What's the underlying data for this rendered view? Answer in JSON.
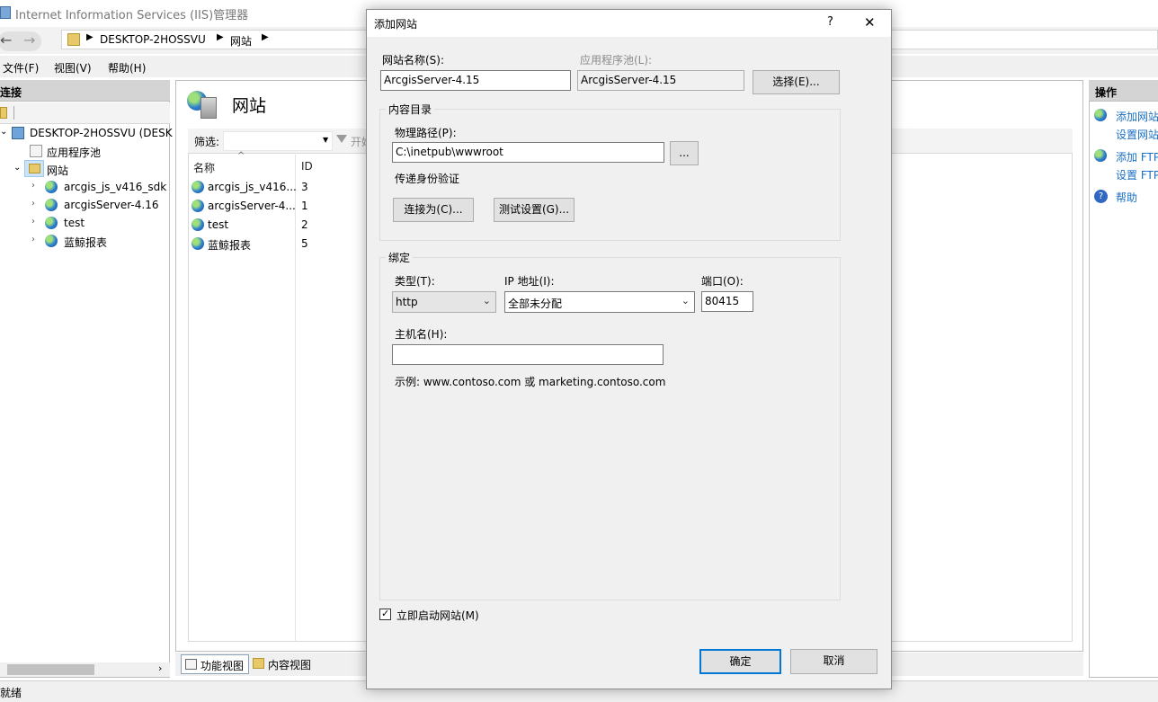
{
  "window": {
    "title": "Internet Information Services (IIS)管理器",
    "breadcrumb": [
      "DESKTOP-2HOSSVU",
      "网站"
    ],
    "menu": [
      "文件(F)",
      "视图(V)",
      "帮助(H)"
    ]
  },
  "connections": {
    "header": "连接",
    "tree": {
      "server": "DESKTOP-2HOSSVU (DESK",
      "app_pools": "应用程序池",
      "sites": "网站",
      "site_nodes": [
        "arcgis_js_v416_sdk",
        "arcgisServer-4.16",
        "test",
        "蓝鲸报表"
      ]
    }
  },
  "center": {
    "title": "网站",
    "filter_label": "筛选:",
    "filter_go": "开始",
    "columns": [
      "名称",
      "ID"
    ],
    "rows": [
      {
        "name": "arcgis_js_v416...",
        "id": "3"
      },
      {
        "name": "arcgisServer-4...",
        "id": "1"
      },
      {
        "name": "test",
        "id": "2"
      },
      {
        "name": "蓝鲸报表",
        "id": "5"
      }
    ],
    "tabs": [
      "功能视图",
      "内容视图"
    ]
  },
  "actions": {
    "header": "操作",
    "links": [
      "添加网站",
      "设置网站",
      "添加 FTP",
      "设置 FTP",
      "帮助"
    ]
  },
  "status": "就绪",
  "dialog": {
    "title": "添加网站",
    "help_glyph": "?",
    "close_glyph": "✕",
    "site_name_label": "网站名称(S):",
    "site_name_value": "ArcgisServer-4.15",
    "app_pool_label": "应用程序池(L):",
    "app_pool_value": "ArcgisServer-4.15",
    "select_button": "选择(E)...",
    "content_dir_label": "内容目录",
    "physical_path_label": "物理路径(P):",
    "physical_path_value": "C:\\inetpub\\wwwroot",
    "browse_button": "...",
    "pass_through_label": "传递身份验证",
    "connect_as_button": "连接为(C)...",
    "test_settings_button": "测试设置(G)...",
    "binding_label": "绑定",
    "type_label": "类型(T):",
    "type_value": "http",
    "ip_label": "IP 地址(I):",
    "ip_value": "全部未分配",
    "port_label": "端口(O):",
    "port_value": "80415",
    "host_label": "主机名(H):",
    "host_value": "",
    "example_text": "示例: www.contoso.com 或 marketing.contoso.com",
    "start_now_label": "立即启动网站(M)",
    "start_now_checked": true,
    "check_glyph": "✓",
    "ok_button": "确定",
    "cancel_button": "取消"
  }
}
